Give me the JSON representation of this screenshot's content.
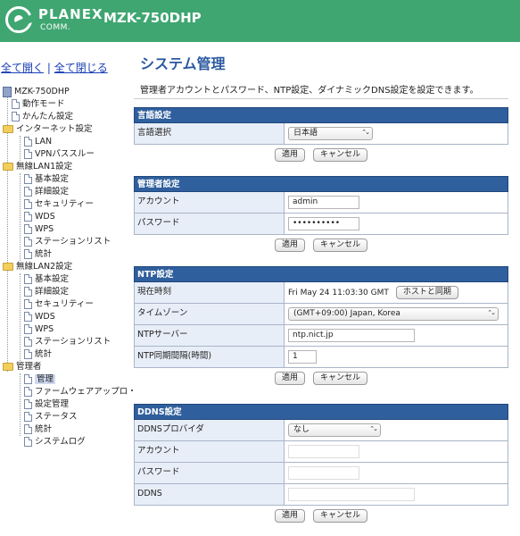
{
  "header": {
    "brand": "PLANEX",
    "brand_sub": "COMM.",
    "model": "MZK-750DHP"
  },
  "sidebar": {
    "expand_all": "全て開く",
    "separator": "|",
    "collapse_all": "全て閉じる",
    "root": "MZK-750DHP",
    "items": [
      {
        "label": "動作モード"
      },
      {
        "label": "かんたん設定"
      },
      {
        "label": "インターネット設定"
      },
      {
        "label": "LAN"
      },
      {
        "label": "VPNパススルー"
      },
      {
        "label": "無線LAN1設定"
      },
      {
        "label": "基本設定"
      },
      {
        "label": "詳細設定"
      },
      {
        "label": "セキュリティー"
      },
      {
        "label": "WDS"
      },
      {
        "label": "WPS"
      },
      {
        "label": "ステーションリスト"
      },
      {
        "label": "統計"
      },
      {
        "label": "無線LAN2設定"
      },
      {
        "label": "基本設定"
      },
      {
        "label": "詳細設定"
      },
      {
        "label": "セキュリティー"
      },
      {
        "label": "WDS"
      },
      {
        "label": "WPS"
      },
      {
        "label": "ステーションリスト"
      },
      {
        "label": "統計"
      },
      {
        "label": "管理者"
      },
      {
        "label": "管理"
      },
      {
        "label": "ファームウェアアップロ・"
      },
      {
        "label": "設定管理"
      },
      {
        "label": "ステータス"
      },
      {
        "label": "統計"
      },
      {
        "label": "システムログ"
      }
    ]
  },
  "main": {
    "title": "システム管理",
    "description": "管理者アカウントとパスワード、NTP設定、ダイナミックDNS設定を設定できます。",
    "apply": "適用",
    "cancel": "キャンセル",
    "language": {
      "heading": "言語設定",
      "select_label": "言語選択",
      "select_value": "日本語"
    },
    "admin": {
      "heading": "管理者設定",
      "account_label": "アカウント",
      "account_value": "admin",
      "password_label": "パスワード",
      "password_value": "••••••••••"
    },
    "ntp": {
      "heading": "NTP設定",
      "time_label": "現在時刻",
      "time_value": "Fri May 24 11:03:30 GMT",
      "sync_button": "ホストと同期",
      "tz_label": "タイムゾーン",
      "tz_value": "(GMT+09:00) Japan, Korea",
      "server_label": "NTPサーバー",
      "server_value": "ntp.nict.jp",
      "interval_label": "NTP同期間隔(時間)",
      "interval_value": "1"
    },
    "ddns": {
      "heading": "DDNS設定",
      "provider_label": "DDNSプロバイダ",
      "provider_value": "なし",
      "account_label": "アカウント",
      "password_label": "パスワード",
      "ddns_label": "DDNS"
    }
  }
}
